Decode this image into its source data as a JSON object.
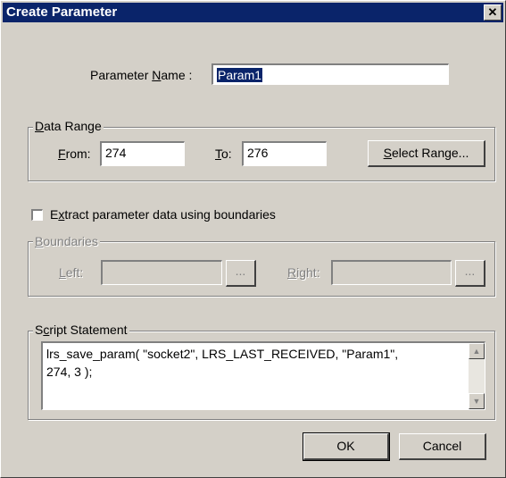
{
  "dialog": {
    "title": "Create Parameter",
    "close_glyph": "✕"
  },
  "param_name": {
    "label_pre": "Parameter ",
    "label_key": "N",
    "label_post": "ame :",
    "value": "Param1"
  },
  "data_range": {
    "legend_key": "D",
    "legend_rest": "ata Range",
    "from_key": "F",
    "from_rest": "rom:",
    "from_value": "274",
    "to_key": "T",
    "to_rest": "o:",
    "to_value": "276",
    "select_pre": "",
    "select_key": "S",
    "select_rest": "elect Range..."
  },
  "extract": {
    "label_pre": "E",
    "label_key": "x",
    "label_rest": "tract parameter data using boundaries",
    "checked": false
  },
  "boundaries": {
    "legend_key": "B",
    "legend_rest": "oundaries",
    "left_key": "L",
    "left_rest": "eft:",
    "right_key": "R",
    "right_rest": "ight:",
    "browse_label": "..."
  },
  "script": {
    "legend_pre": "S",
    "legend_key": "c",
    "legend_rest": "ript Statement",
    "line1": "lrs_save_param( \"socket2\", LRS_LAST_RECEIVED, \"Param1\",",
    "line2": "274, 3 );"
  },
  "buttons": {
    "ok": "OK",
    "cancel": "Cancel"
  },
  "colors": {
    "titlebar": "#0a246a",
    "face": "#d4d0c8"
  }
}
